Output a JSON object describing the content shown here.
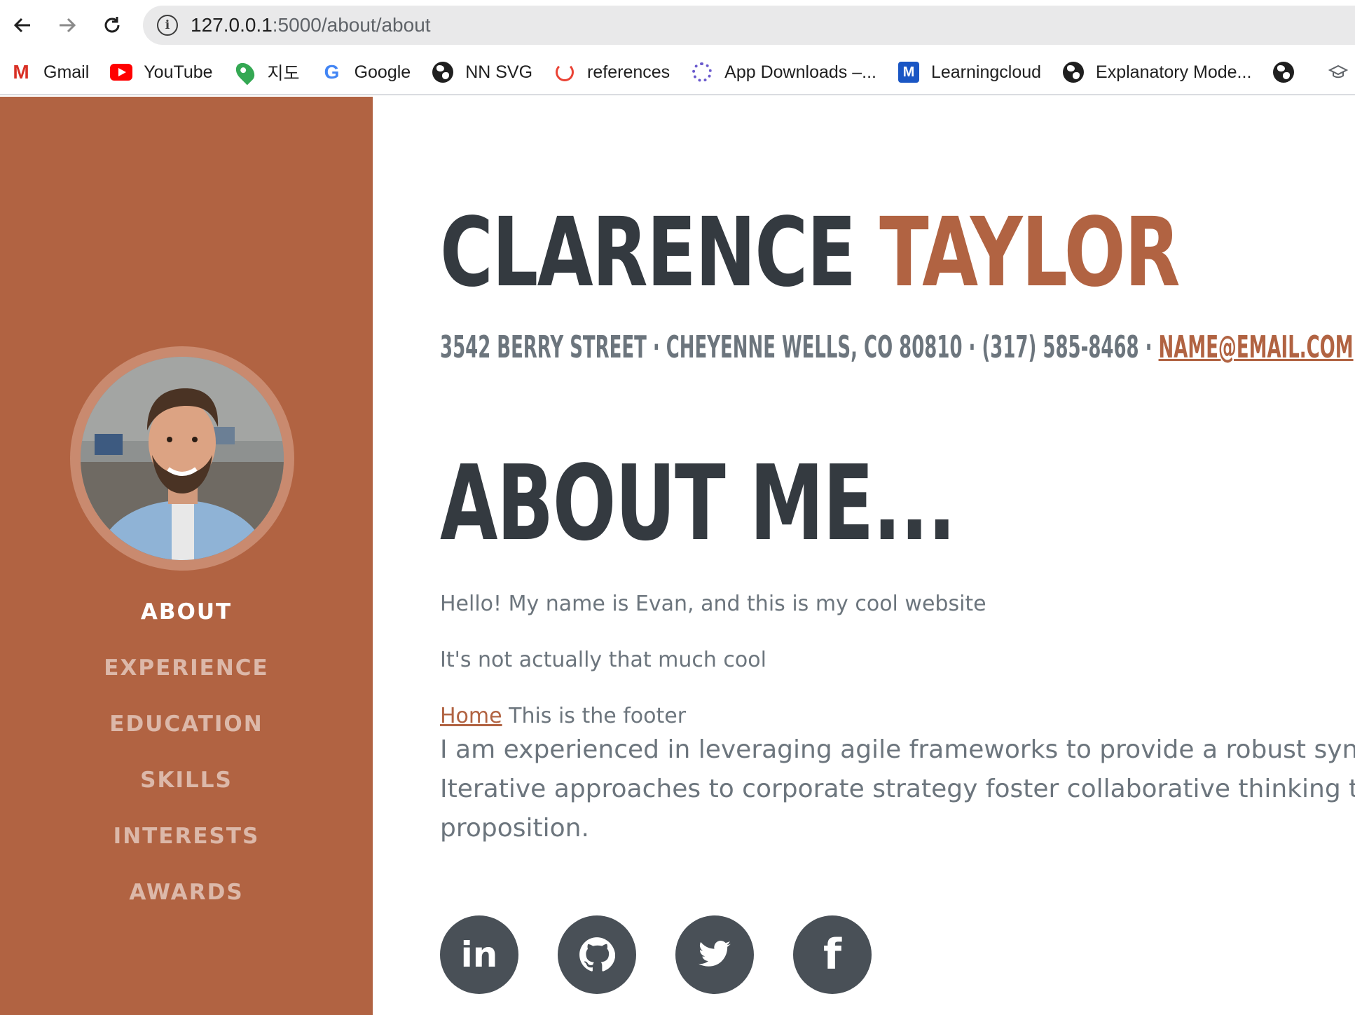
{
  "browser": {
    "url_host": "127.0.0.1",
    "url_path": ":5000/about/about",
    "bookmarks": [
      {
        "label": "Gmail",
        "icon": "gmail-icon"
      },
      {
        "label": "YouTube",
        "icon": "youtube-icon"
      },
      {
        "label": "지도",
        "icon": "maps-icon"
      },
      {
        "label": "Google",
        "icon": "google-icon"
      },
      {
        "label": "NN SVG",
        "icon": "globe-icon"
      },
      {
        "label": "references",
        "icon": "references-icon"
      },
      {
        "label": "App Downloads –...",
        "icon": "app-downloads-icon"
      },
      {
        "label": "Learningcloud",
        "icon": "learningcloud-icon"
      },
      {
        "label": "Explanatory Mode...",
        "icon": "globe-icon"
      },
      {
        "label": "",
        "icon": "globe-icon"
      },
      {
        "label": "",
        "icon": "graduation-cap-icon"
      }
    ]
  },
  "sidebar": {
    "nav": [
      "ABOUT",
      "EXPERIENCE",
      "EDUCATION",
      "SKILLS",
      "INTERESTS",
      "AWARDS"
    ],
    "active": "ABOUT"
  },
  "profile": {
    "first_name": "CLARENCE",
    "last_name": "TAYLOR",
    "address": "3542 BERRY STREET · CHEYENNE WELLS, CO 80810 · (317) 585-8468 · ",
    "email": "NAME@EMAIL.COM"
  },
  "about": {
    "heading": "ABOUT ME...",
    "para1": "Hello! My name is Evan, and this is my cool website",
    "para2": "It's not actually that much cool",
    "footer_link": "Home",
    "footer_text": " This is the footer",
    "lead_line1": "I am experienced in leveraging agile frameworks to provide a robust synopsis",
    "lead_line2": "Iterative approaches to corporate strategy foster collaborative thinking to furt",
    "lead_line3": "proposition."
  },
  "social": [
    {
      "name": "linkedin",
      "glyph": "in"
    },
    {
      "name": "github",
      "glyph": ""
    },
    {
      "name": "twitter",
      "glyph": ""
    },
    {
      "name": "facebook",
      "glyph": "f"
    }
  ],
  "colors": {
    "accent": "#b16342",
    "dark": "#343a40",
    "muted": "#6c757d",
    "social_bg": "#495057"
  }
}
